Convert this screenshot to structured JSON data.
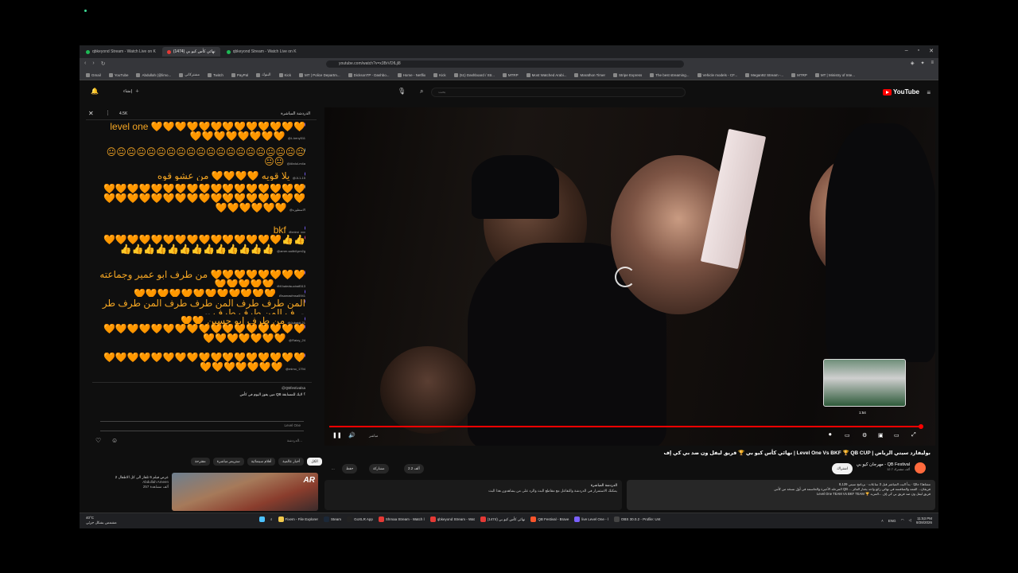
{
  "browser": {
    "tabs": [
      {
        "label": "qbkeyond Stream - Watch Live on K",
        "active": false
      },
      {
        "label": "نهائي كأس كيو بي (1474)",
        "active": true
      },
      {
        "label": "qbkeyond Stream - Watch Live on K",
        "active": false
      }
    ],
    "url": "youtube.com/watch?v=x3BrVDfLjl8",
    "bookmarks": [
      "Gmail",
      "YouTube",
      "Abdullah (@limo...",
      "مشتركاتي",
      "Twitch",
      "PayPal",
      "البنوك",
      "Kick",
      "MT | Police Departm...",
      "DicksonTP - Dashbo...",
      "Home - Netflix",
      "Kick",
      "(51) Dashboard / Str...",
      "MTRP",
      "Most Watched Arabi...",
      "Marathon Timer",
      "Stripe Express",
      "The best streaming...",
      "Vehicle models - CF...",
      "Megan92 Stream -...",
      "MTRP",
      "MT | Ministry of Inte..."
    ]
  },
  "youtube": {
    "create_label": "إنشاء",
    "search_placeholder": "بحث",
    "logo_text": "YouTube"
  },
  "chat": {
    "header_title": "الدردشة المباشرة",
    "header_count": "4.5K",
    "messages": [
      {
        "author": "@L.keny511",
        "text": "level one 🧡🧡🧡🧡🧡🧡🧡🧡🧡🧡🧡🧡🧡🧡🧡🧡🧡🧡🧡🧡🧡"
      },
      {
        "author": "@Abdul-m4a",
        "text": "😐😐😐😐😐😐😐😐😐😐😐😐😐😐😐😐😐😐😐😐😐😐"
      },
      {
        "author": "@JL1-15",
        "text": "يلا قويه 🧡🧡🧡🧡 من عشو قوه"
      },
      {
        "author": "@الاسطوره",
        "text": "🧡🧡🧡🧡🧡🧡🧡🧡🧡🧡🧡🧡🧡🧡🧡🧡🧡🧡🧡🧡🧡🧡🧡🧡🧡🧡🧡🧡🧡🧡🧡🧡🧡🧡🧡🧡🧡🧡🧡🧡"
      },
      {
        "author": "@mtmi_xxv",
        "text": "bkf"
      },
      {
        "author": "@amer-saiibi1pm2g",
        "text": "🧡🧡🧡🧡🧡🧡🧡🧡🧡🧡🧡🧡🧡🧡🧡👍👍👍👍👍👍👍👍👍👍👍👍👍👍👍"
      },
      {
        "author": "@Khaledsuoirafi513",
        "text": "من طرف ابو عمير وجماعته 🧡🧡🧡🧡🧡🧡🧡🧡🧡🧡🧡🧡🧡"
      },
      {
        "author": "@samasfmsa5941",
        "text": "🧡🧡🧡🧡🧡🧡🧡🧡🧡🧡🧡🧡"
      },
      {
        "author": "@3zz_alliu",
        "text": "المن طرف طرف المن طرف طرف المن طرف طرف المن طرف طرف"
      },
      {
        "author": "@Jubaidi-21",
        "text": "🧡🧡 من طرف ابو حسين"
      },
      {
        "author": "@Ratzy_24",
        "text": "🧡🧡🧡🧡🧡🧡🧡🧡🧡🧡🧡🧡🧡🧡🧡🧡🧡🧡🧡🧡🧡🧡🧡🧡"
      },
      {
        "author": "@mimo_1794",
        "text": "🧡🧡🧡🧡🧡🧡🧡🧡🧡🧡🧡🧡🧡🧡🧡🧡🧡🧡🧡🧡🧡🧡🧡🧡"
      }
    ],
    "pinned_author": "@QBfestivalsa",
    "pinned_text": "مين يفوز اليوم في كأس QB ؟ لايك للمسابقة",
    "input_placeholder": "الدردشة...",
    "pinned_label": "Level One",
    "char_count": "0/200"
  },
  "related": {
    "chips": [
      "الكل",
      "أخبار عالمية",
      "أفلام سينمائية",
      "ستريمز مباشرة",
      "مقترحة"
    ],
    "video_title": "عرض فيلم 6 تلفاز الى كل الاطفال 2",
    "channel": "Abdullah Ameen",
    "views": "257 ألف مشاهدة",
    "thumb_text": "AR"
  },
  "player": {
    "preview_time": "1:54",
    "progress_fraction": 0.99,
    "live_label": "مباشر"
  },
  "video": {
    "title": "نهائي كأس كيو بي 🏆 فريق ليفل ون ضد بي كي إف | Level One Vs BKF 🏆 QB CUP | بوليفارد سيتي الرياض",
    "channel_name": "مهرجان كيو بي - QB Festival",
    "channel_subs": "12.7 ألف مشترك",
    "subscribe_label": "اشتراك",
    "like_count": "2.2 ألف",
    "share_label": "مشاركة",
    "save_label": "حفظ",
    "more_label": "...",
    "description": "8,129 مشاهدًا حاليًا · بدأ البث المباشر قبل 3 ساعات · برنامج سيتي\nالمرحلة الأخيرة والحاسمة في أول نسخة من كأس QB ... فريقان... القمة والمنافسة في نهائي رائع واحد يختار الفائز\nLevel One TEAM Vs BKF TEAM 🏆 فريق ليفل ون ضد فريق بي كي إف ...المزيد",
    "live_chat_title": "الدردشة المباشرة",
    "live_chat_text": "يمكنك الاستمرار في الدردشة والتفاعل مع مقاطع البث والرد على من يشاهدون هذا البث"
  },
  "taskbar": {
    "weather_temp": "40°C",
    "weather_desc": "مشمس بشكل جزئي",
    "items": [
      "Fixem - File Explorer",
      "Steam",
      "GoXLR App",
      "Shmaa Stream - Watch l",
      "qbkeyond Stream - Wat",
      "نهائي كأس كيو بي (1474)",
      "QB Festival - Brave",
      "live Level One - l",
      "OBS 30.0.2 - Profile: Unt"
    ],
    "lang": "ENG",
    "time": "11:53 PM",
    "date": "8/28/2026"
  },
  "colors": {
    "accent_red": "#ff0000",
    "heart_orange": "#f5a623",
    "bg": "#0f0f0f"
  }
}
